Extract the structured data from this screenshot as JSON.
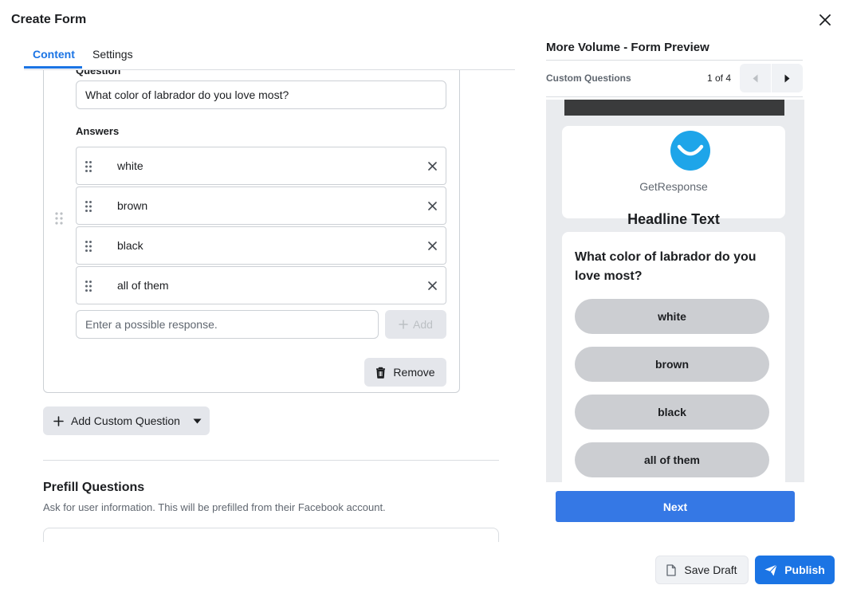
{
  "dialog": {
    "title": "Create Form",
    "close_icon": "close-icon"
  },
  "tabs": [
    {
      "label": "Content",
      "active": true
    },
    {
      "label": "Settings",
      "active": false
    }
  ],
  "question_editor": {
    "question_label": "Question",
    "question_value": "What color of labrador do you love most?",
    "answers_label": "Answers",
    "answers": [
      "white",
      "brown",
      "black",
      "all of them"
    ],
    "response_placeholder": "Enter a possible response.",
    "add_label": "Add",
    "remove_label": "Remove"
  },
  "add_custom_question_label": "Add Custom Question",
  "prefill": {
    "title": "Prefill Questions",
    "description": "Ask for user information. This will be prefilled from their Facebook account."
  },
  "preview": {
    "title": "More Volume - Form Preview",
    "section": "Custom Questions",
    "page_indicator": "1 of 4",
    "brand_name": "GetResponse",
    "headline": "Headline Text",
    "question": "What color of labrador do you love most?",
    "options": [
      "white",
      "brown",
      "black",
      "all of them"
    ],
    "next_label": "Next",
    "logo_color": "#1ea5e9"
  },
  "footer": {
    "save_draft_label": "Save Draft",
    "publish_label": "Publish"
  },
  "colors": {
    "accent": "#1b74e4",
    "next_button": "#3578e5"
  }
}
